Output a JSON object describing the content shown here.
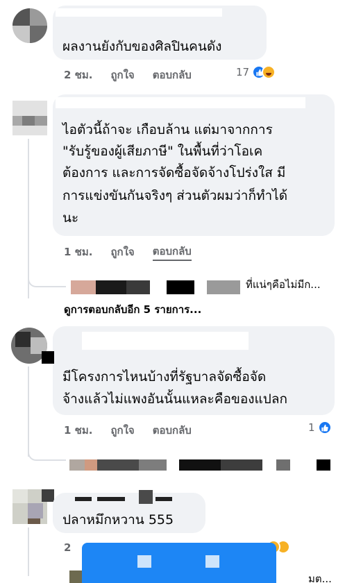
{
  "colors": {
    "bubble": "#f0f2f5",
    "action_text": "#65676b",
    "like_blue": "#1877f2",
    "overlay_blue": "#1d86f5",
    "thread_line": "#dcdfe4"
  },
  "comments": [
    {
      "text_lines": [
        "ผลงานยังกับของศิลปินคนดัง"
      ],
      "time": "2 ชม.",
      "like_label": "ถูกใจ",
      "reply_label": "ตอบกลับ",
      "reaction_count": "17",
      "reaction_icons": [
        "like-icon",
        "haha-icon"
      ]
    },
    {
      "text_lines": [
        "ไอตัวนี้ถ้าจะ เกือบล้าน แต่มาจากการ",
        "\"รับรู้ของผู้เสียภาษี\" ในพื้นที่ว่าโอเค",
        "ต้องการ และการจัดซื้อจัดจ้างโปร่งใส มี",
        "การแข่งขันกันจริงๆ ส่วนตัวผมว่าก็ทำได้",
        "นะ"
      ],
      "time": "1 ชม.",
      "like_label": "ถูกใจ",
      "reply_label": "ตอบกลับ",
      "reply_preview": "ที่แน่ๆคือไม่มีก...",
      "more_replies": "ดูการตอบกลับอีก 5 รายการ..."
    },
    {
      "text_lines": [
        "มีโครงการไหนบ้างที่รัฐบาลจัดซื้อจัด",
        "จ้างแล้วไม่แพงอันนั้นแหละคือของแปลก"
      ],
      "time": "1 ชม.",
      "like_label": "ถูกใจ",
      "reply_label": "ตอบกลับ",
      "reaction_count": "1",
      "reaction_icons": [
        "like-icon"
      ]
    },
    {
      "text_lines": [
        "ปลาหมึกหวาน 555"
      ],
      "time": "2",
      "reaction_icons": [
        "haha-icon",
        "care-icon"
      ],
      "reply_preview": "มต..."
    }
  ]
}
